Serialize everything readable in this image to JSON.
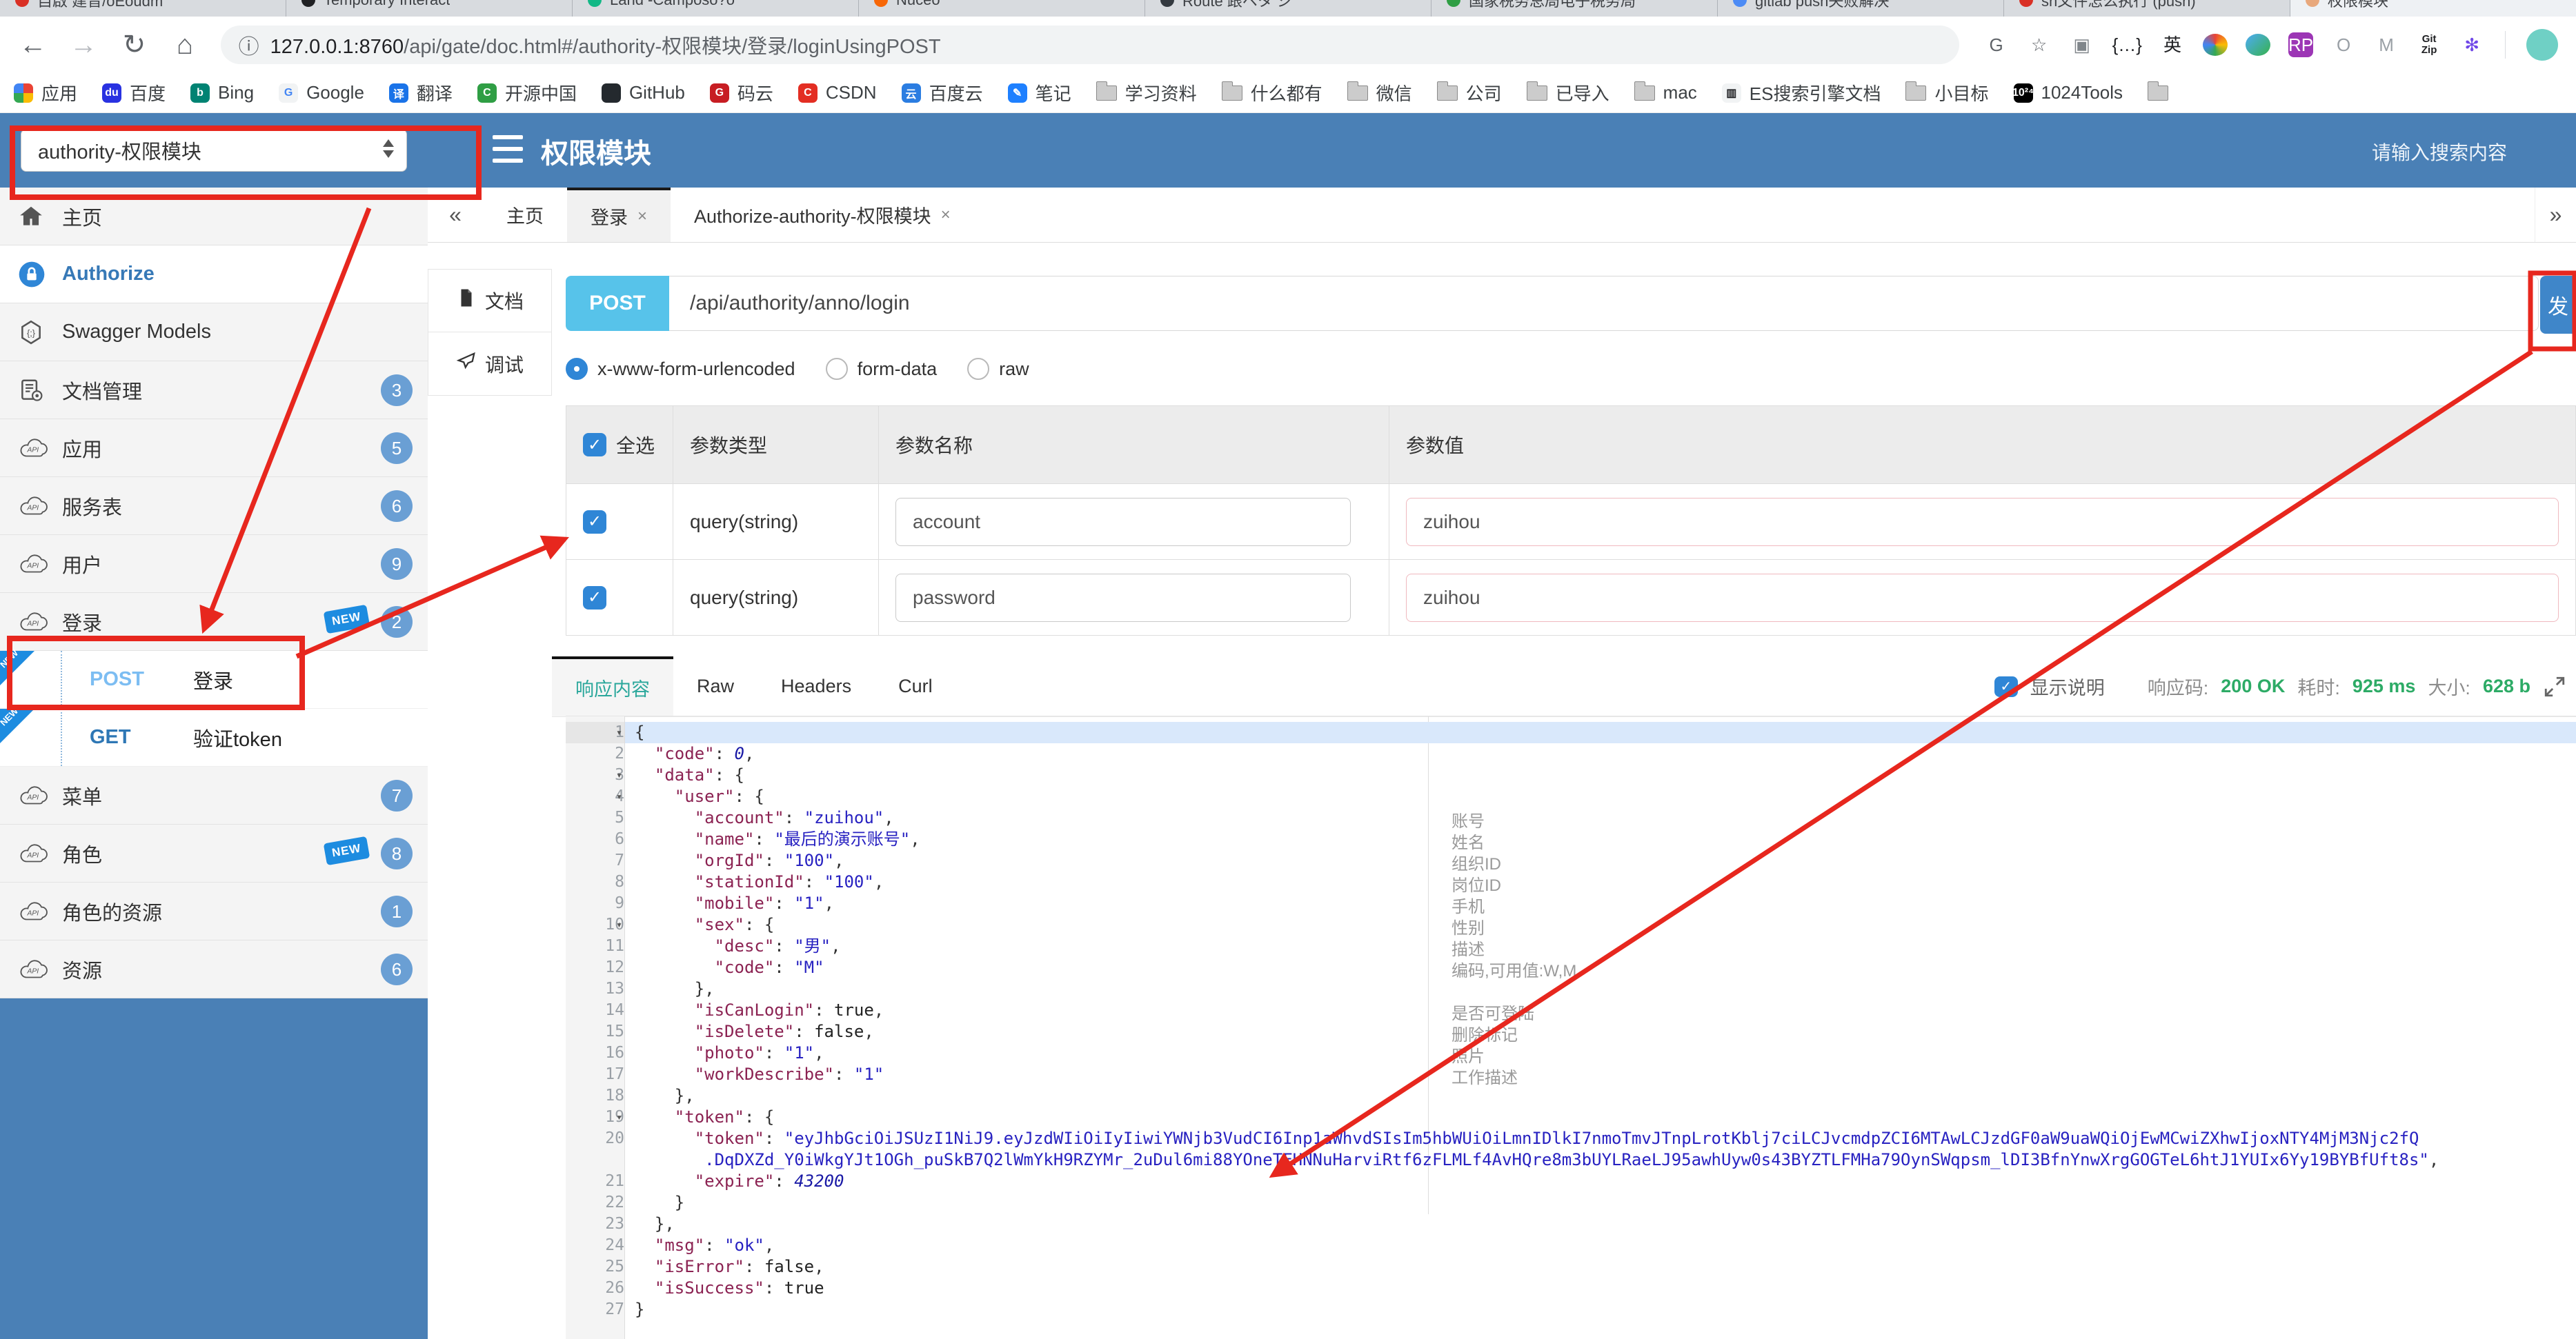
{
  "browser": {
    "tabs": [
      {
        "label": "自啟 建音/oEoudm",
        "color": "#d93025",
        "active": false
      },
      {
        "label": "Temporary Interact",
        "color": "#202124",
        "active": false
      },
      {
        "label": "Land -Camposo?o",
        "color": "#12b886",
        "active": false
      },
      {
        "label": "Nuceo",
        "color": "#f76707",
        "active": false
      },
      {
        "label": "Route 跟ベタ ジ",
        "color": "#343a40",
        "active": false
      },
      {
        "label": "国家税务总局电子税务局",
        "color": "#2f9e44",
        "active": false
      },
      {
        "label": "gitlab push失败解决",
        "color": "#4c8bf5",
        "active": false
      },
      {
        "label": "sh文件怎么执行 (push)",
        "color": "#d93025",
        "active": false
      },
      {
        "label": "权限模块",
        "color": "#e8a87c",
        "active": true
      }
    ],
    "url": {
      "host": "127.0.0.1:8760",
      "path": "/api/gate/doc.html#/authority-权限模块/登录/loginUsingPOST"
    },
    "extensions": [
      {
        "name": "translate-icon",
        "glyph": "G",
        "fg": "#5f6368"
      },
      {
        "name": "bookmark-star-icon",
        "glyph": "☆",
        "fg": "#5f6368"
      },
      {
        "name": "reader-icon",
        "glyph": "▣",
        "fg": "#80868b"
      },
      {
        "name": "json-formatter-icon",
        "glyph": "{…}",
        "fg": "#202124"
      },
      {
        "name": "en-dict-icon",
        "glyph": "英",
        "fg": "#202124"
      },
      {
        "name": "color-wheel-icon",
        "glyph": "",
        "fg": "",
        "cls": "wheel"
      },
      {
        "name": "globe-icon",
        "glyph": "",
        "fg": "",
        "cls": "globe"
      },
      {
        "name": "rp-icon",
        "glyph": "RP",
        "fg": "#fff",
        "bg": "#9c36b5"
      },
      {
        "name": "oval-icon",
        "glyph": "O",
        "fg": "#9aa0a6"
      },
      {
        "name": "m-chevron-icon",
        "glyph": "M",
        "fg": "#9aa0a6"
      },
      {
        "name": "gitzip-icon",
        "glyph": "Git\nZip",
        "fg": "#202124",
        "cls": "gitzip"
      },
      {
        "name": "axe-icon",
        "glyph": "✻",
        "fg": "#7048e8"
      }
    ],
    "bookmarks": [
      {
        "label": "应用",
        "icon": "apps-grid-icon",
        "cls": "apps"
      },
      {
        "label": "百度",
        "icon": "baidu-icon",
        "bg": "#2932e1",
        "glyph": "du"
      },
      {
        "label": "Bing",
        "icon": "bing-icon",
        "bg": "#008373",
        "glyph": "b"
      },
      {
        "label": "Google",
        "icon": "google-icon",
        "bg": "#f1f3f4",
        "glyph": "G",
        "fg": "#4285f4"
      },
      {
        "label": "翻译",
        "icon": "translate-icon",
        "bg": "#1a73e8",
        "glyph": "译"
      },
      {
        "label": "开源中国",
        "icon": "oschina-icon",
        "bg": "#2f9e44",
        "glyph": "C"
      },
      {
        "label": "GitHub",
        "icon": "github-icon",
        "bg": "#24292e",
        "glyph": ""
      },
      {
        "label": "码云",
        "icon": "gitee-icon",
        "bg": "#c71d23",
        "glyph": "G"
      },
      {
        "label": "CSDN",
        "icon": "csdn-icon",
        "bg": "#e32e23",
        "glyph": "C"
      },
      {
        "label": "百度云",
        "icon": "baiduyun-icon",
        "bg": "#2b7de1",
        "glyph": "云"
      },
      {
        "label": "笔记",
        "icon": "note-icon",
        "bg": "#1e80ff",
        "glyph": "✎"
      },
      {
        "label": "学习资料",
        "icon": "folder-icon"
      },
      {
        "label": "什么都有",
        "icon": "folder-icon"
      },
      {
        "label": "微信",
        "icon": "folder-icon"
      },
      {
        "label": "公司",
        "icon": "folder-icon"
      },
      {
        "label": "已导入",
        "icon": "folder-icon"
      },
      {
        "label": "mac",
        "icon": "folder-icon"
      },
      {
        "label": "ES搜索引擎文档",
        "icon": "book-icon",
        "bg": "#f1f3f4",
        "glyph": "▥",
        "fg": "#202124"
      },
      {
        "label": "小目标",
        "icon": "folder-icon"
      },
      {
        "label": "1024Tools",
        "icon": "tools1024-icon",
        "bg": "#000000",
        "glyph": "10²⁴"
      },
      {
        "label": "",
        "icon": "folder-icon"
      }
    ]
  },
  "header": {
    "select_value": "authority-权限模块",
    "title": "权限模块",
    "search_placeholder": "请输入搜索内容",
    "bg": "#4a80b6"
  },
  "sidebar": {
    "rows": [
      {
        "kind": "item",
        "icon": "home-icon",
        "label": "主页"
      },
      {
        "kind": "item",
        "icon": "lock-icon",
        "label": "Authorize",
        "style": "auth"
      },
      {
        "kind": "item",
        "icon": "models-icon",
        "label": "Swagger Models"
      },
      {
        "kind": "item",
        "icon": "doc-manage-icon",
        "label": "文档管理",
        "badge": "3"
      },
      {
        "kind": "item",
        "icon": "api-cloud-icon",
        "label": "应用",
        "badge": "5"
      },
      {
        "kind": "item",
        "icon": "api-cloud-icon",
        "label": "服务表",
        "badge": "6"
      },
      {
        "kind": "item",
        "icon": "api-cloud-icon",
        "label": "用户",
        "badge": "9"
      },
      {
        "kind": "item",
        "icon": "api-cloud-icon",
        "label": "登录",
        "badge": "2",
        "new_tag": true
      },
      {
        "kind": "sub",
        "method": "POST",
        "label": "登录",
        "new_corner": true
      },
      {
        "kind": "sub",
        "method": "GET",
        "label": "验证token",
        "new_corner": true
      },
      {
        "kind": "item",
        "icon": "api-cloud-icon",
        "label": "菜单",
        "badge": "7"
      },
      {
        "kind": "item",
        "icon": "api-cloud-icon",
        "label": "角色",
        "badge": "8",
        "new_tag": true
      },
      {
        "kind": "item",
        "icon": "api-cloud-icon",
        "label": "角色的资源",
        "badge": "1"
      },
      {
        "kind": "item",
        "icon": "api-cloud-icon",
        "label": "资源",
        "badge": "6"
      }
    ]
  },
  "tabs_nav": {
    "left": "«",
    "right": "»"
  },
  "content_tabs": [
    {
      "label": "主页",
      "closable": false,
      "active": false
    },
    {
      "label": "登录",
      "closable": true,
      "active": true
    },
    {
      "label": "Authorize-authority-权限模块",
      "closable": true,
      "active": false
    }
  ],
  "doc_tabs": [
    {
      "label": "文档",
      "icon": "document-icon",
      "active": false
    },
    {
      "label": "调试",
      "icon": "debug-icon",
      "active": true
    }
  ],
  "request": {
    "method": "POST",
    "path": "/api/authority/anno/login",
    "send_label": "发",
    "method_color": "#57c3ea",
    "body_types": [
      {
        "label": "x-www-form-urlencoded",
        "selected": true
      },
      {
        "label": "form-data",
        "selected": false
      },
      {
        "label": "raw",
        "selected": false
      }
    ]
  },
  "params": {
    "select_all": "全选",
    "headers": [
      "参数类型",
      "参数名称",
      "参数值"
    ],
    "rows": [
      {
        "checked": true,
        "type": "query(string)",
        "name": "account",
        "value": "zuihou"
      },
      {
        "checked": true,
        "type": "query(string)",
        "name": "password",
        "value": "zuihou"
      }
    ]
  },
  "response": {
    "tabs": [
      {
        "label": "响应内容",
        "active": true
      },
      {
        "label": "Raw",
        "active": false
      },
      {
        "label": "Headers",
        "active": false
      },
      {
        "label": "Curl",
        "active": false
      }
    ],
    "show_desc": "显示说明",
    "stats": [
      {
        "label": "响应码:",
        "value": "200 OK"
      },
      {
        "label": "耗时:",
        "value": "925 ms"
      },
      {
        "label": "大小:",
        "value": "628 b"
      }
    ]
  },
  "code": {
    "rows": [
      {
        "no": "1",
        "fold": true,
        "hl": true,
        "t": [
          [
            "p",
            "{"
          ]
        ]
      },
      {
        "no": "2",
        "t": [
          [
            "p",
            "  "
          ],
          [
            "k",
            "\"code\""
          ],
          [
            "p",
            ": "
          ],
          [
            "n",
            "0"
          ],
          [
            "p",
            ","
          ]
        ]
      },
      {
        "no": "3",
        "fold": true,
        "t": [
          [
            "p",
            "  "
          ],
          [
            "k",
            "\"data\""
          ],
          [
            "p",
            ": {"
          ]
        ]
      },
      {
        "no": "4",
        "fold": true,
        "t": [
          [
            "p",
            "    "
          ],
          [
            "k",
            "\"user\""
          ],
          [
            "p",
            ": {"
          ]
        ]
      },
      {
        "no": "5",
        "t": [
          [
            "p",
            "      "
          ],
          [
            "k",
            "\"account\""
          ],
          [
            "p",
            ": "
          ],
          [
            "s",
            "\"zuihou\""
          ],
          [
            "p",
            ","
          ]
        ]
      },
      {
        "no": "6",
        "t": [
          [
            "p",
            "      "
          ],
          [
            "k",
            "\"name\""
          ],
          [
            "p",
            ": "
          ],
          [
            "s",
            "\"最后的演示账号\""
          ],
          [
            "p",
            ","
          ]
        ]
      },
      {
        "no": "7",
        "t": [
          [
            "p",
            "      "
          ],
          [
            "k",
            "\"orgId\""
          ],
          [
            "p",
            ": "
          ],
          [
            "s",
            "\"100\""
          ],
          [
            "p",
            ","
          ]
        ]
      },
      {
        "no": "8",
        "t": [
          [
            "p",
            "      "
          ],
          [
            "k",
            "\"stationId\""
          ],
          [
            "p",
            ": "
          ],
          [
            "s",
            "\"100\""
          ],
          [
            "p",
            ","
          ]
        ]
      },
      {
        "no": "9",
        "t": [
          [
            "p",
            "      "
          ],
          [
            "k",
            "\"mobile\""
          ],
          [
            "p",
            ": "
          ],
          [
            "s",
            "\"1\""
          ],
          [
            "p",
            ","
          ]
        ]
      },
      {
        "no": "10",
        "fold": true,
        "t": [
          [
            "p",
            "      "
          ],
          [
            "k",
            "\"sex\""
          ],
          [
            "p",
            ": {"
          ]
        ]
      },
      {
        "no": "11",
        "t": [
          [
            "p",
            "        "
          ],
          [
            "k",
            "\"desc\""
          ],
          [
            "p",
            ": "
          ],
          [
            "s",
            "\"男\""
          ],
          [
            "p",
            ","
          ]
        ]
      },
      {
        "no": "12",
        "t": [
          [
            "p",
            "        "
          ],
          [
            "k",
            "\"code\""
          ],
          [
            "p",
            ": "
          ],
          [
            "s",
            "\"M\""
          ]
        ]
      },
      {
        "no": "13",
        "t": [
          [
            "p",
            "      },"
          ]
        ]
      },
      {
        "no": "14",
        "t": [
          [
            "p",
            "      "
          ],
          [
            "k",
            "\"isCanLogin\""
          ],
          [
            "p",
            ": "
          ],
          [
            "b",
            "true"
          ],
          [
            "p",
            ","
          ]
        ]
      },
      {
        "no": "15",
        "t": [
          [
            "p",
            "      "
          ],
          [
            "k",
            "\"isDelete\""
          ],
          [
            "p",
            ": "
          ],
          [
            "b",
            "false"
          ],
          [
            "p",
            ","
          ]
        ]
      },
      {
        "no": "16",
        "t": [
          [
            "p",
            "      "
          ],
          [
            "k",
            "\"photo\""
          ],
          [
            "p",
            ": "
          ],
          [
            "s",
            "\"1\""
          ],
          [
            "p",
            ","
          ]
        ]
      },
      {
        "no": "17",
        "t": [
          [
            "p",
            "      "
          ],
          [
            "k",
            "\"workDescribe\""
          ],
          [
            "p",
            ": "
          ],
          [
            "s",
            "\"1\""
          ]
        ]
      },
      {
        "no": "18",
        "t": [
          [
            "p",
            "    },"
          ]
        ]
      },
      {
        "no": "19",
        "fold": true,
        "t": [
          [
            "p",
            "    "
          ],
          [
            "k",
            "\"token\""
          ],
          [
            "p",
            ": {"
          ]
        ]
      },
      {
        "no": "20",
        "t": [
          [
            "p",
            "      "
          ],
          [
            "k",
            "\"token\""
          ],
          [
            "p",
            ": "
          ],
          [
            "s",
            "\"eyJhbGciOiJSUzI1NiJ9.eyJzdWIiOiIyIiwiYWNjb3VudCI6Inp1aWhvdSIsIm5hbWUiOiLmnIDlkI7nmoTmvJTnpLrotKblj7ciLCJvcmdpZCI6MTAwLCJzdGF0aW9uaWQiOjEwMCwiZXhwIjoxNTY4MjM3Njc2fQ"
          ]
        ]
      },
      {
        "no": "",
        "t": [
          [
            "s",
            "       .DqDXZd_Y0iWkgYJt1OGh_puSkB7Q2lWmYkH9RZYMr_2uDul6mi88YOneTFHNNuHarviRtf6zFLMLf4AvHQre8m3bUYLRaeLJ95awhUyw0s43BYZTLFMHa79OynSWqpsm_lDI3BfnYnwXrgGOGTeL6htJ1YUIx6Yy19BYBfUft8s\""
          ],
          [
            "p",
            ","
          ]
        ]
      },
      {
        "no": "21",
        "t": [
          [
            "p",
            "      "
          ],
          [
            "k",
            "\"expire\""
          ],
          [
            "p",
            ": "
          ],
          [
            "n",
            "43200"
          ]
        ]
      },
      {
        "no": "22",
        "t": [
          [
            "p",
            "    }"
          ]
        ]
      },
      {
        "no": "23",
        "t": [
          [
            "p",
            "  },"
          ]
        ]
      },
      {
        "no": "24",
        "t": [
          [
            "p",
            "  "
          ],
          [
            "k",
            "\"msg\""
          ],
          [
            "p",
            ": "
          ],
          [
            "s",
            "\"ok\""
          ],
          [
            "p",
            ","
          ]
        ]
      },
      {
        "no": "25",
        "t": [
          [
            "p",
            "  "
          ],
          [
            "k",
            "\"isError\""
          ],
          [
            "p",
            ": "
          ],
          [
            "b",
            "false"
          ],
          [
            "p",
            ","
          ]
        ]
      },
      {
        "no": "26",
        "t": [
          [
            "p",
            "  "
          ],
          [
            "k",
            "\"isSuccess\""
          ],
          [
            "p",
            ": "
          ],
          [
            "b",
            "true"
          ]
        ]
      },
      {
        "no": "27",
        "t": [
          [
            "p",
            "}"
          ]
        ]
      }
    ],
    "annotations": [
      {
        "row": 5,
        "text": "账号"
      },
      {
        "row": 6,
        "text": "姓名"
      },
      {
        "row": 7,
        "text": "组织ID"
      },
      {
        "row": 8,
        "text": "岗位ID"
      },
      {
        "row": 9,
        "text": "手机"
      },
      {
        "row": 10,
        "text": "性别"
      },
      {
        "row": 11,
        "text": "描述"
      },
      {
        "row": 12,
        "text": "编码,可用值:W,M"
      },
      {
        "row": 14,
        "text": "是否可登陆"
      },
      {
        "row": 15,
        "text": "删除标记"
      },
      {
        "row": 16,
        "text": "照片"
      },
      {
        "row": 17,
        "text": "工作描述"
      }
    ]
  },
  "annotation_color": "#e7271e"
}
